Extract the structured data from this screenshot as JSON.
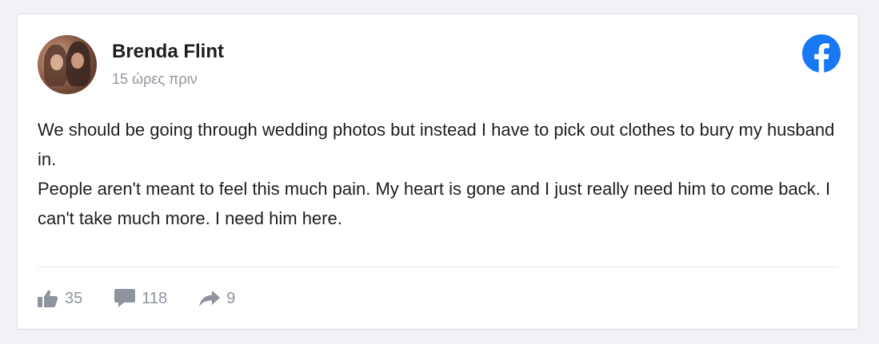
{
  "post": {
    "author": "Brenda Flint",
    "time": "15 ώρες πριν",
    "paragraph_1": "We should be going through wedding photos but instead I have to pick out clothes to bury my husband in.",
    "paragraph_2": "People aren't meant to feel this much pain. My heart is gone and I just really need him to come back. I can't take much more. I need him here."
  },
  "stats": {
    "likes": "35",
    "comments": "118",
    "shares": "9"
  },
  "colors": {
    "brand": "#1877f2",
    "stat_gray": "#8d949e"
  },
  "icons": {
    "logo": "facebook-logo-icon",
    "like": "thumbs-up-icon",
    "comment": "comment-bubble-icon",
    "share": "share-arrow-icon"
  }
}
